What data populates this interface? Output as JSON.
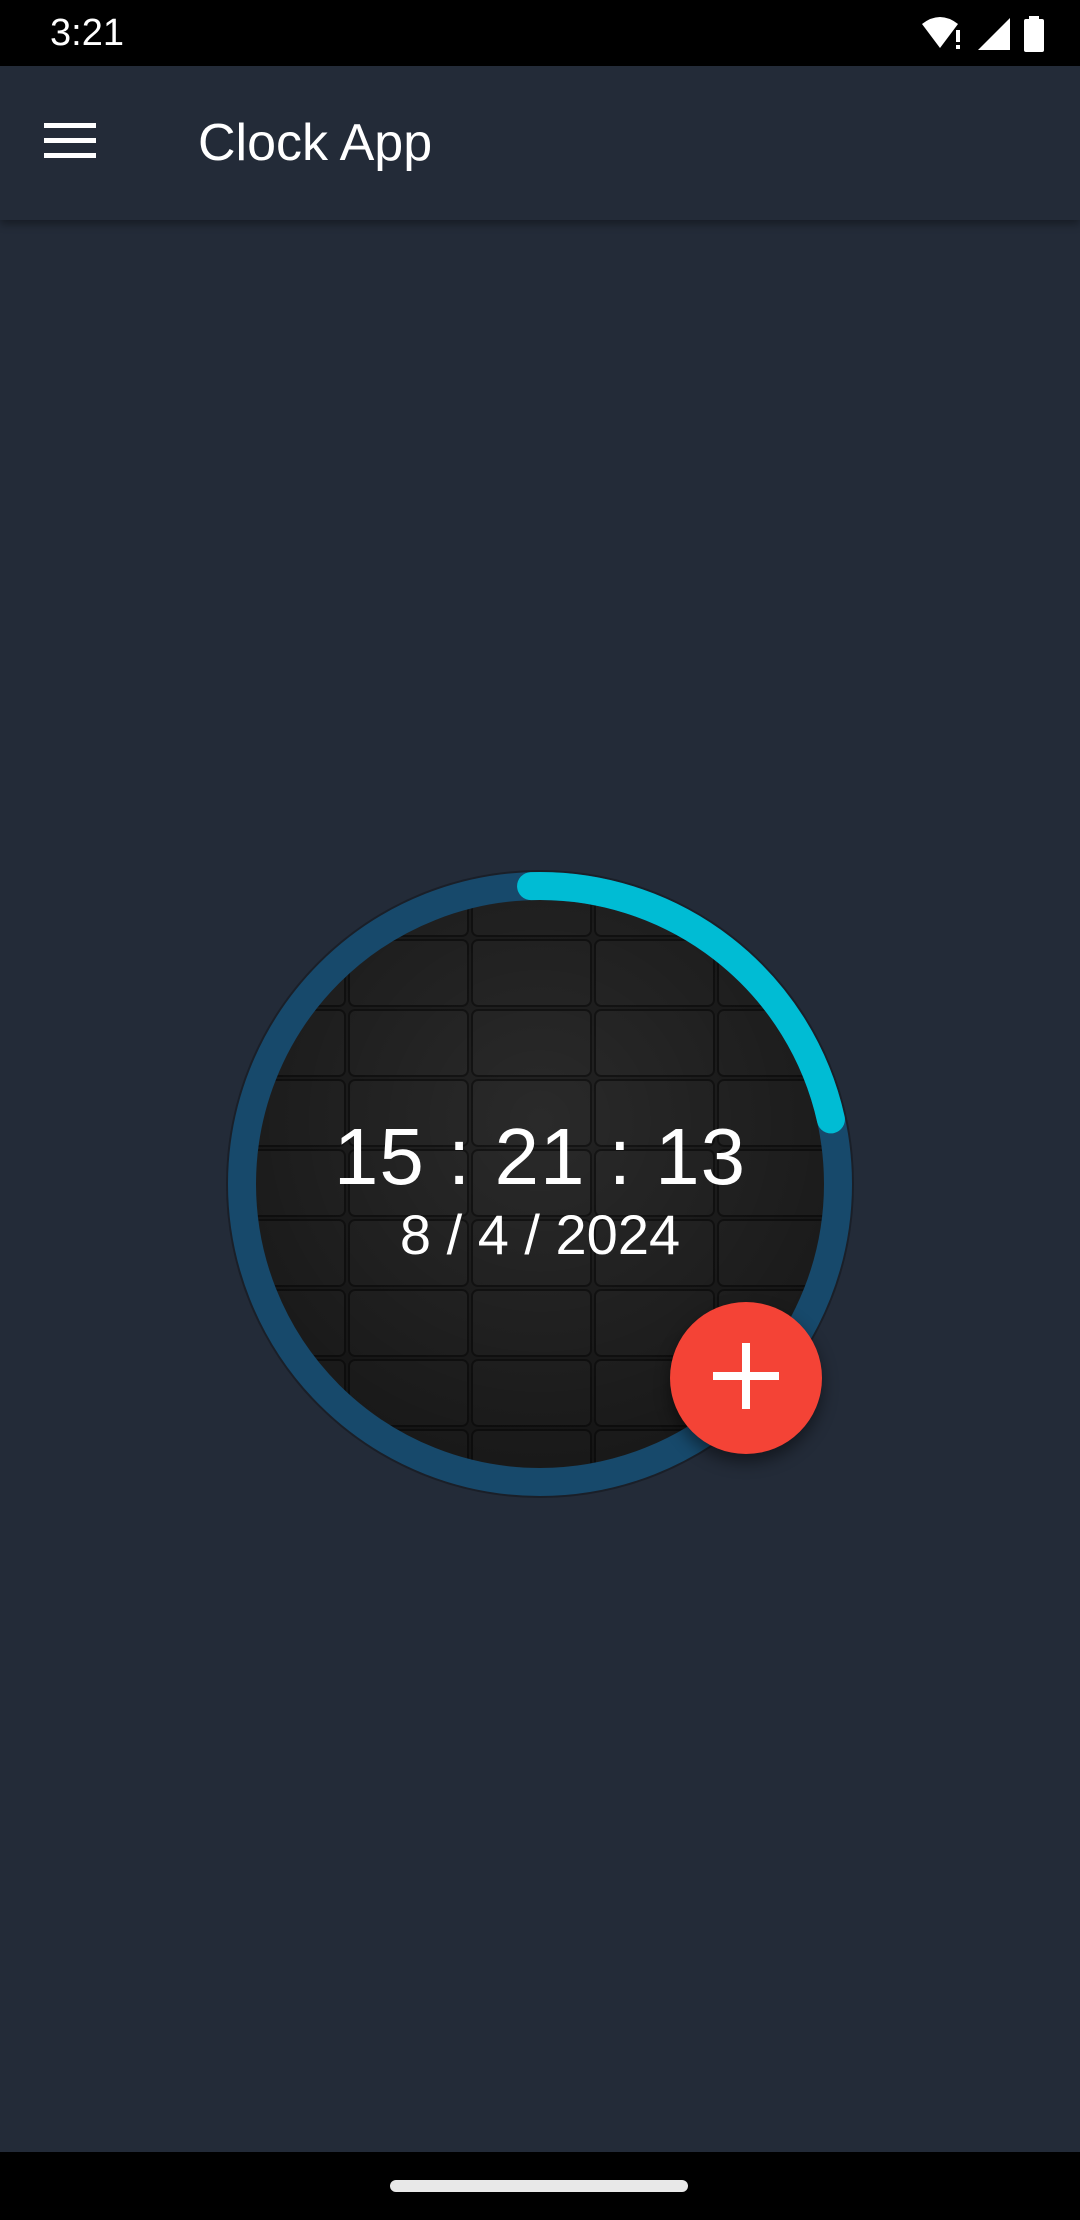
{
  "status_bar": {
    "time": "3:21",
    "icons": [
      "wifi-alert-icon",
      "cellular-signal-icon",
      "battery-icon"
    ]
  },
  "app_bar": {
    "menu_icon": "hamburger-menu-icon",
    "title": "Clock App"
  },
  "clock": {
    "time": "15 : 21 : 13",
    "date": "8 / 4 / 2024",
    "seconds_progress_fraction": 0.22,
    "colors": {
      "ring_track": "#17496b",
      "ring_progress": "#00bcd4",
      "face": "#1b1b1b"
    }
  },
  "fab": {
    "icon": "plus-icon",
    "color": "#f44336"
  },
  "colors": {
    "background": "#232b38",
    "system_bars": "#000000",
    "text": "#ffffff"
  }
}
